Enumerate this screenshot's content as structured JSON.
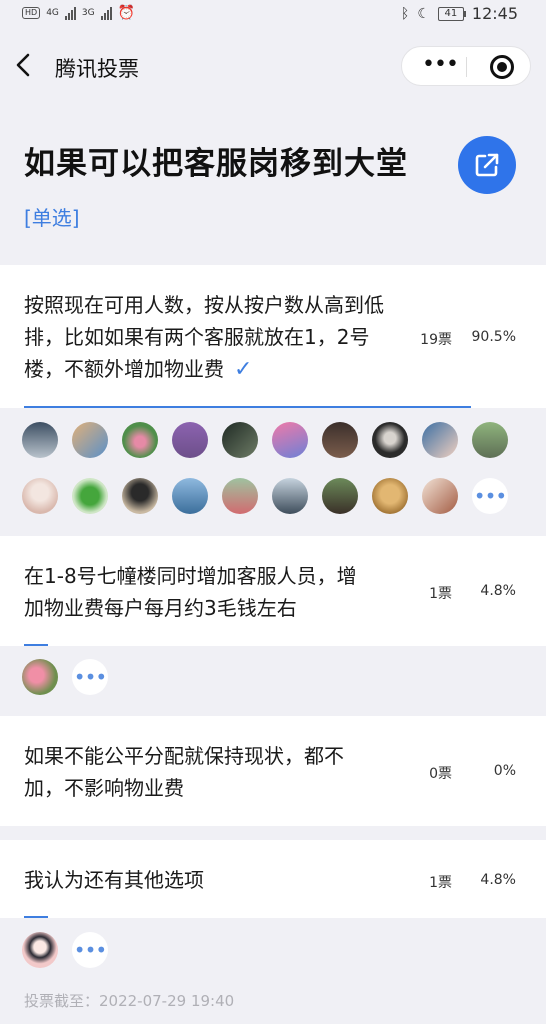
{
  "status_bar": {
    "hd_badge": "HD",
    "net1": "4G",
    "net2": "3G",
    "battery": "41",
    "time": "12:45",
    "icons": [
      "alarm-icon",
      "bluetooth-icon",
      "moon-icon"
    ]
  },
  "nav": {
    "back_icon": "chevron-left-icon",
    "title": "腾讯投票",
    "more_icon": "more-dots-icon",
    "close_icon": "target-circle-icon"
  },
  "vote": {
    "title": "如果可以把客服岗移到大堂",
    "type": "[单选]",
    "share_icon": "external-link-icon",
    "accent_color": "#2f74ea",
    "deadline": "投票截至：2022-07-29 19:40"
  },
  "options": [
    {
      "text": "按照现在可用人数，按从按户数从高到低排，比如如果有两个客服就放在1，2号楼，不额外增加物业费",
      "votes": "19票",
      "percent": "90.5%",
      "fraction": 0.905,
      "selected": true,
      "avatars": 19,
      "has_more": true
    },
    {
      "text": "在1-8号七幢楼同时增加客服人员，增加物业费每户每月约3毛钱左右",
      "votes": "1票",
      "percent": "4.8%",
      "fraction": 0.048,
      "selected": false,
      "avatars": 1,
      "has_more": true
    },
    {
      "text": "如果不能公平分配就保持现状，都不加，不影响物业费",
      "votes": "0票",
      "percent": "0%",
      "fraction": 0,
      "selected": false,
      "avatars": 0,
      "has_more": false
    },
    {
      "text": "我认为还有其他选项",
      "votes": "1票",
      "percent": "4.8%",
      "fraction": 0.048,
      "selected": false,
      "avatars": 1,
      "has_more": true
    }
  ]
}
